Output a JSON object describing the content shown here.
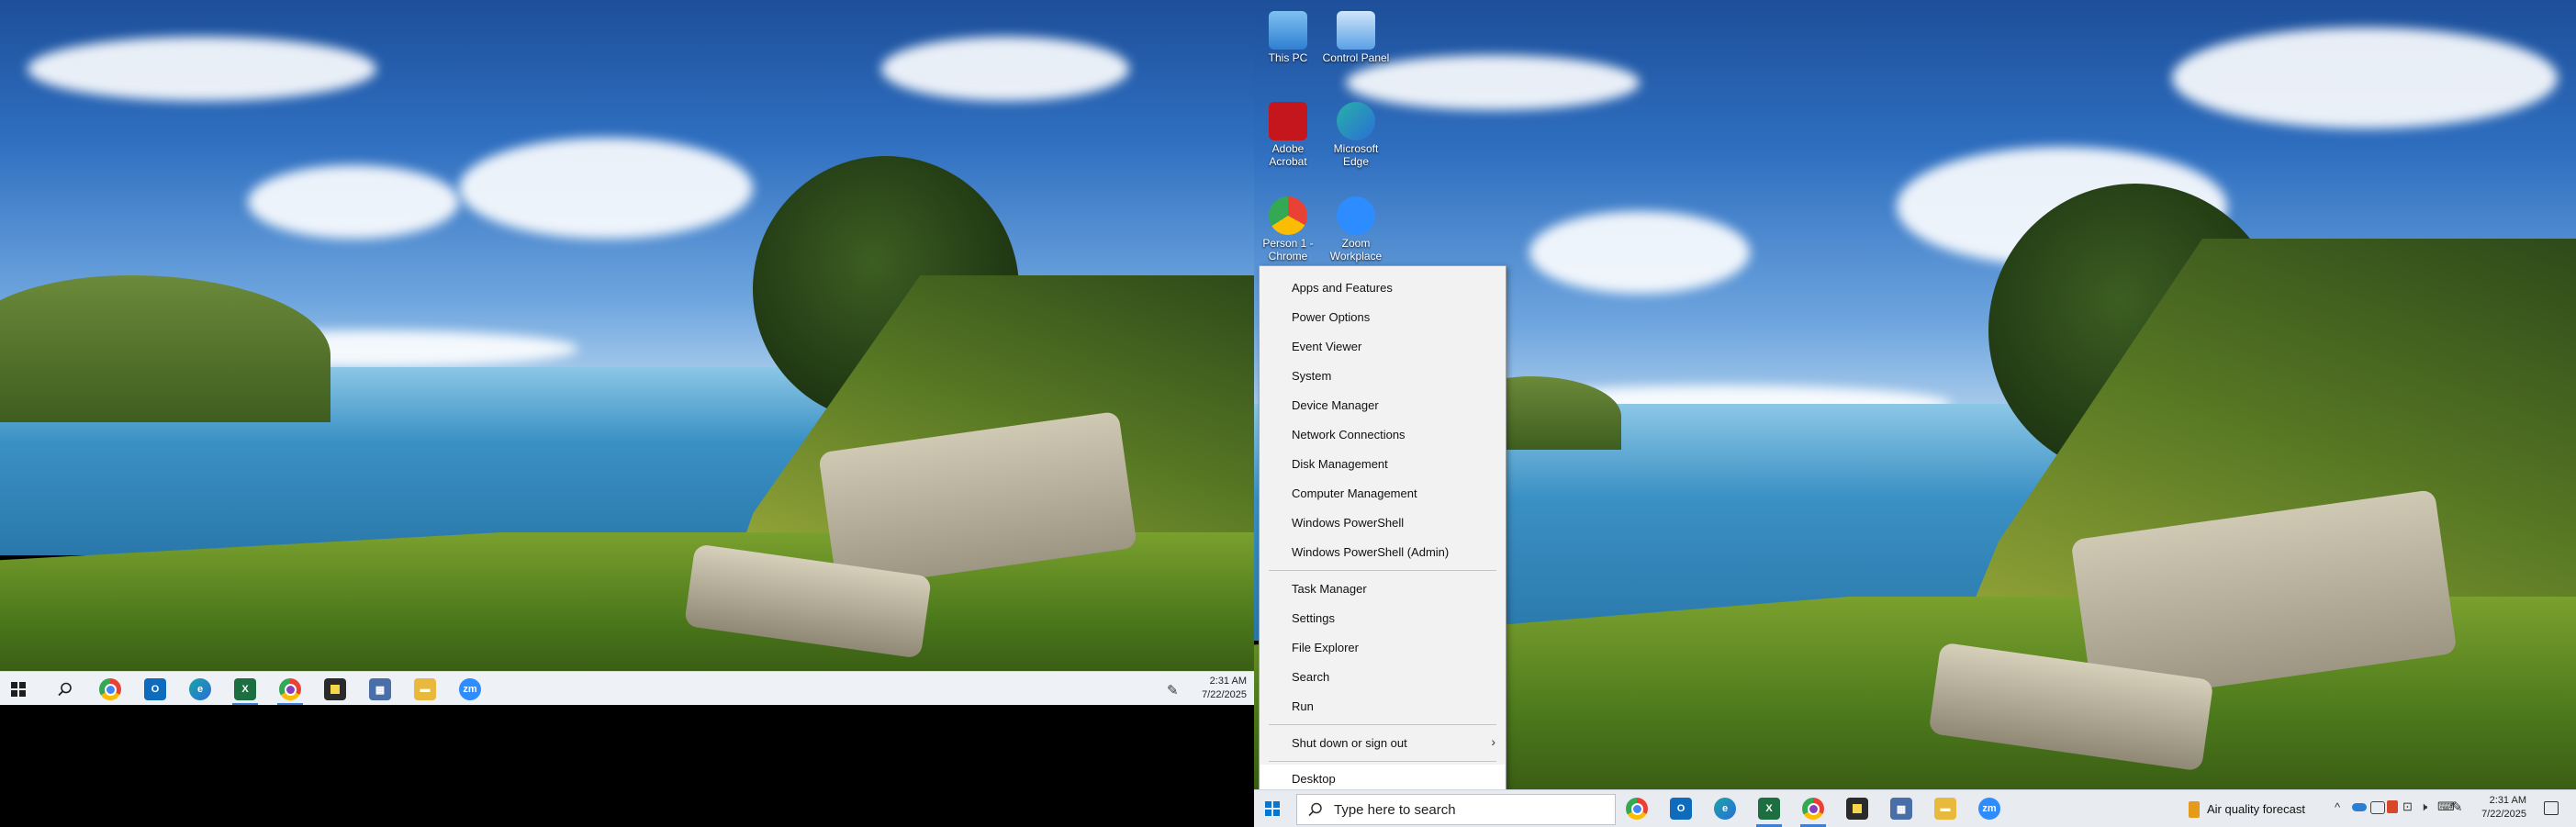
{
  "left_screen": {
    "taskbar": {
      "pinned": [
        {
          "name": "start-button",
          "color": "#1e1e1e"
        },
        {
          "name": "search-icon",
          "color": "#1e1e1e"
        },
        {
          "name": "chrome-icon",
          "color": "#e94235"
        },
        {
          "name": "outlook-icon",
          "color": "#0f6cbd"
        },
        {
          "name": "edge-icon",
          "color": "#1aa3a8"
        },
        {
          "name": "excel-icon",
          "color": "#1d6f42"
        },
        {
          "name": "chrome-profile-icon",
          "color": "#e94235"
        },
        {
          "name": "sticky-notes-icon",
          "color": "#2b2b2b"
        },
        {
          "name": "calculator-icon",
          "color": "#4a6ea8"
        },
        {
          "name": "file-explorer-icon",
          "color": "#e8b93c"
        },
        {
          "name": "zoom-icon",
          "color": "#2d8cff",
          "label": "zm"
        }
      ],
      "clock": {
        "time": "2:31 AM",
        "date": "7/22/2025"
      }
    }
  },
  "right_screen": {
    "desktop_icons": [
      {
        "label": "This PC",
        "color": "#3d8ee0"
      },
      {
        "label": "Control Panel",
        "color": "#5aa0e6"
      },
      {
        "label": "Adobe Acrobat",
        "color": "#c4161c"
      },
      {
        "label": "Microsoft Edge",
        "color": "#27b1a6"
      },
      {
        "label": "Person 1 - Chrome",
        "color": "#e94235"
      },
      {
        "label": "Zoom Workplace",
        "color": "#2d8cff"
      }
    ],
    "context_menu": {
      "group1": [
        "Apps and Features",
        "Power Options",
        "Event Viewer",
        "System",
        "Device Manager",
        "Network Connections",
        "Disk Management",
        "Computer Management",
        "Windows PowerShell",
        "Windows PowerShell (Admin)"
      ],
      "group2": [
        "Task Manager",
        "Settings",
        "File Explorer",
        "Search",
        "Run"
      ],
      "shutdown": "Shut down or sign out",
      "desktop": "Desktop",
      "chevron": "›"
    },
    "taskbar": {
      "search_placeholder": "Type here to search",
      "weather": "Air quality forecast",
      "tray_chevron": "^",
      "clock": {
        "time": "2:31 AM",
        "date": "7/22/2025"
      },
      "zoom_label": "zm"
    }
  }
}
